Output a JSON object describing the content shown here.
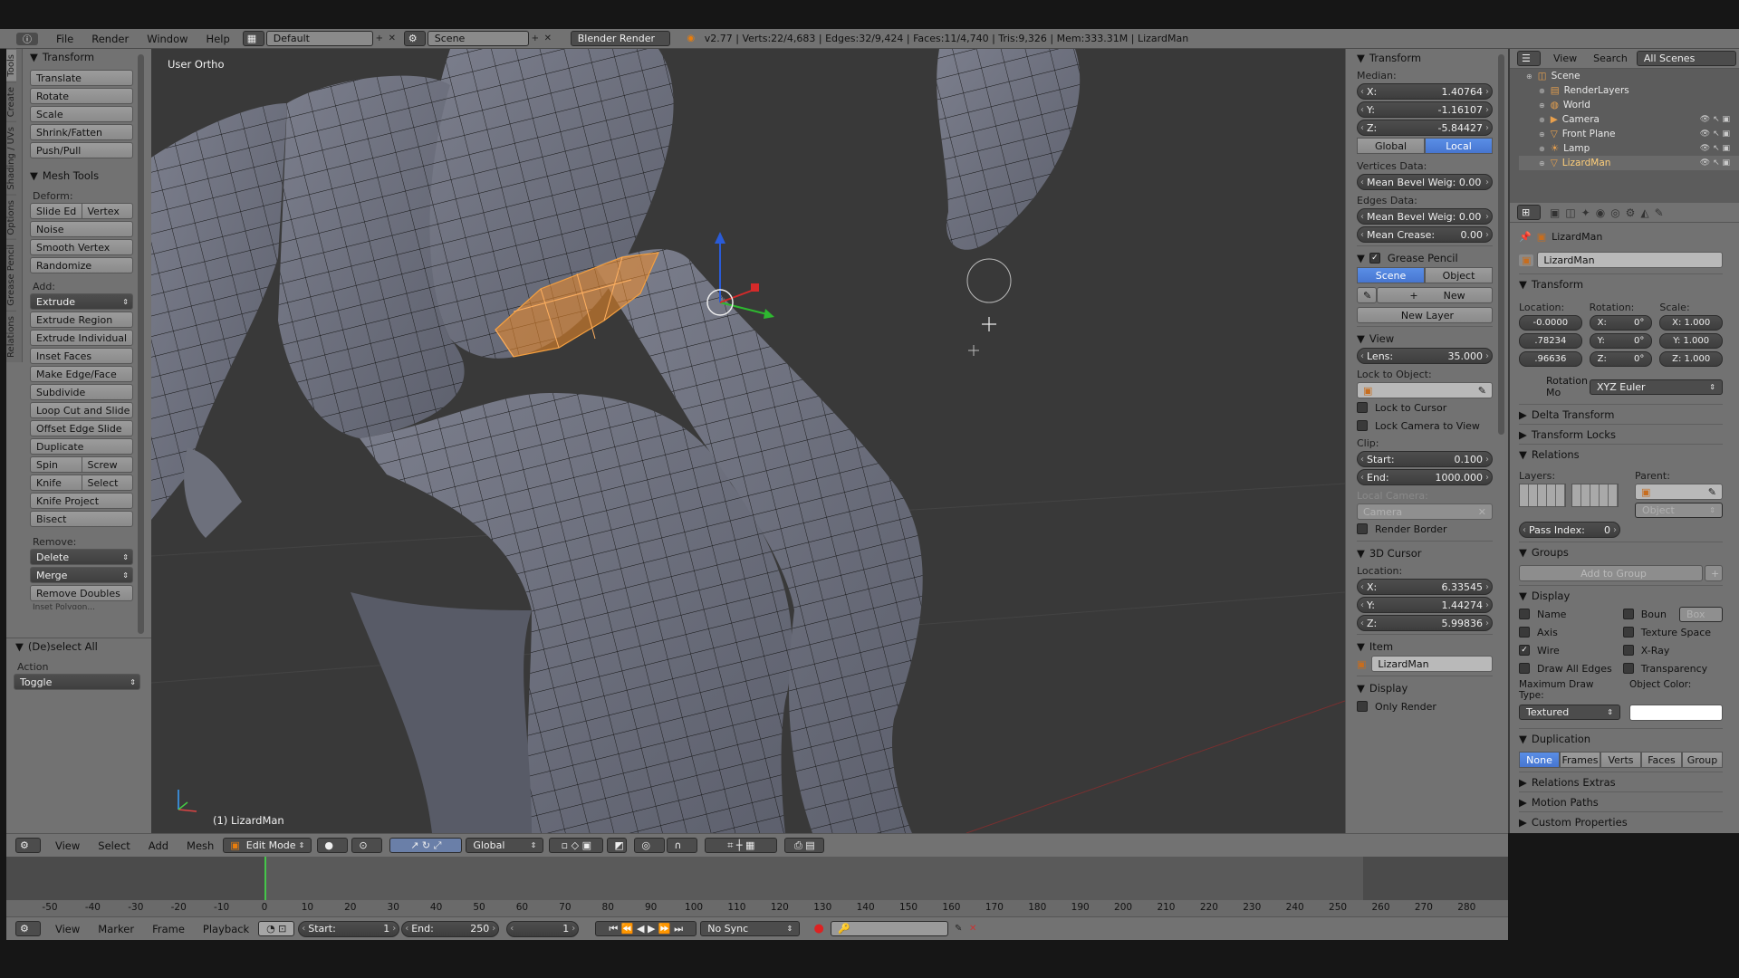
{
  "topbar": {
    "menus": [
      "File",
      "Render",
      "Window",
      "Help"
    ],
    "layout": "Default",
    "scene": "Scene",
    "engine": "Blender Render",
    "stats": "v2.77 | Verts:22/4,683 | Edges:32/9,424 | Faces:11/4,740 | Tris:9,326 | Mem:333.31M | LizardMan"
  },
  "tool_tabs": [
    "Tools",
    "Create",
    "Shading / UVs",
    "Options",
    "Grease Pencil",
    "Relations"
  ],
  "tools": {
    "transform_header": "Transform",
    "transform_buttons": [
      "Translate",
      "Rotate",
      "Scale",
      "Shrink/Fatten",
      "Push/Pull"
    ],
    "mesh_tools_header": "Mesh Tools",
    "deform_label": "Deform:",
    "slide_edge": "Slide Ed",
    "vertex": "Vertex",
    "deform_buttons": [
      "Noise",
      "Smooth Vertex",
      "Randomize"
    ],
    "add_label": "Add:",
    "extrude": "Extrude",
    "add_buttons": [
      "Extrude Region",
      "Extrude Individual",
      "Inset Faces",
      "Make Edge/Face",
      "Subdivide",
      "Loop Cut and Slide",
      "Offset Edge Slide",
      "Duplicate"
    ],
    "spin": "Spin",
    "screw": "Screw",
    "knife": "Knife",
    "select": "Select",
    "knife_project": "Knife Project",
    "bisect": "Bisect",
    "remove_label": "Remove:",
    "delete": "Delete",
    "merge": "Merge",
    "remove_doubles": "Remove Doubles",
    "cut_off": "Inset Polygon...",
    "operator_header": "(De)select All",
    "action_label": "Action",
    "action_value": "Toggle"
  },
  "viewport": {
    "view_label": "User Ortho",
    "object_label": "(1) LizardMan"
  },
  "npanel": {
    "transform_header": "Transform",
    "median_label": "Median:",
    "median": [
      {
        "axis": "X:",
        "value": "1.40764"
      },
      {
        "axis": "Y:",
        "value": "-1.16107"
      },
      {
        "axis": "Z:",
        "value": "-5.84427"
      }
    ],
    "global": "Global",
    "local": "Local",
    "vertices_data": "Vertices Data:",
    "mean_bevel_v": "Mean Bevel Weig: 0.00",
    "edges_data": "Edges Data:",
    "mean_bevel_e": "Mean Bevel Weig: 0.00",
    "mean_crease_label": "Mean Crease:",
    "mean_crease": "0.00",
    "grease_header": "Grease Pencil",
    "scene_btn": "Scene",
    "object_btn": "Object",
    "new_btn": "New",
    "new_layer": "New Layer",
    "view_header": "View",
    "lens_label": "Lens:",
    "lens": "35.000",
    "lock_object": "Lock to Object:",
    "lock_cursor": "Lock to Cursor",
    "lock_camera": "Lock Camera to View",
    "clip_label": "Clip:",
    "clip_start_label": "Start:",
    "clip_start": "0.100",
    "clip_end_label": "End:",
    "clip_end": "1000.000",
    "local_camera": "Local Camera:",
    "camera": "Camera",
    "render_border": "Render Border",
    "cursor_header": "3D Cursor",
    "location_label": "Location:",
    "cursor": [
      {
        "axis": "X:",
        "value": "6.33545"
      },
      {
        "axis": "Y:",
        "value": "1.44274"
      },
      {
        "axis": "Z:",
        "value": "5.99836"
      }
    ],
    "item_header": "Item",
    "item_name": "LizardMan",
    "display_header": "Display",
    "only_render": "Only Render"
  },
  "outliner": {
    "view": "View",
    "search": "Search",
    "filter": "All Scenes",
    "items": [
      "Scene",
      "RenderLayers",
      "World",
      "Camera",
      "Front Plane",
      "Lamp",
      "LizardMan"
    ]
  },
  "properties": {
    "breadcrumb": "LizardMan",
    "object_name": "LizardMan",
    "transform_header": "Transform",
    "location_label": "Location:",
    "rotation_label": "Rotation:",
    "scale_label": "Scale:",
    "location": [
      "-0.0000",
      ".78234",
      ".96636"
    ],
    "rotation": [
      {
        "a": "X:",
        "v": "0°"
      },
      {
        "a": "Y:",
        "v": "0°"
      },
      {
        "a": "Z:",
        "v": "0°"
      }
    ],
    "scale": [
      "X: 1.000",
      "Y: 1.000",
      "Z: 1.000"
    ],
    "rotation_mode_label": "Rotation Mo",
    "rotation_mode": "XYZ Euler",
    "delta_transform": "Delta Transform",
    "transform_locks": "Transform Locks",
    "relations_header": "Relations",
    "layers_label": "Layers:",
    "parent_label": "Parent:",
    "parent_type": "Object",
    "pass_index_label": "Pass Index:",
    "pass_index": "0",
    "groups_header": "Groups",
    "add_to_group": "Add to Group",
    "display_header": "Display",
    "name": "Name",
    "bounds": "Boun",
    "box": "Box",
    "axis": "Axis",
    "texture_space": "Texture Space",
    "wire": "Wire",
    "xray": "X-Ray",
    "draw_all_edges": "Draw All Edges",
    "transparency": "Transparency",
    "max_draw_type_label": "Maximum Draw Type:",
    "object_color_label": "Object Color:",
    "max_draw_type": "Textured",
    "duplication_header": "Duplication",
    "dup_buttons": [
      "None",
      "Frames",
      "Verts",
      "Faces",
      "Group"
    ],
    "relations_extras": "Relations Extras",
    "motion_paths": "Motion Paths",
    "custom_properties": "Custom Properties"
  },
  "view3d_header": {
    "menus": [
      "View",
      "Select",
      "Add",
      "Mesh"
    ],
    "mode": "Edit Mode",
    "orientation": "Global"
  },
  "timeline": {
    "ticks": [
      "-50",
      "-40",
      "-30",
      "-20",
      "-10",
      "0",
      "10",
      "20",
      "30",
      "40",
      "50",
      "60",
      "70",
      "80",
      "90",
      "100",
      "110",
      "120",
      "130",
      "140",
      "150",
      "160",
      "170",
      "180",
      "190",
      "200",
      "210",
      "220",
      "230",
      "240",
      "250",
      "260",
      "270",
      "280"
    ],
    "menus": [
      "View",
      "Marker",
      "Frame",
      "Playback"
    ],
    "start_label": "Start:",
    "start": "1",
    "end_label": "End:",
    "end": "250",
    "current": "1",
    "sync": "No Sync"
  },
  "colors": {
    "accent": "#5680c2",
    "selection": "#f28c28",
    "ui_grey": "#727272",
    "viewport": "#393939"
  }
}
